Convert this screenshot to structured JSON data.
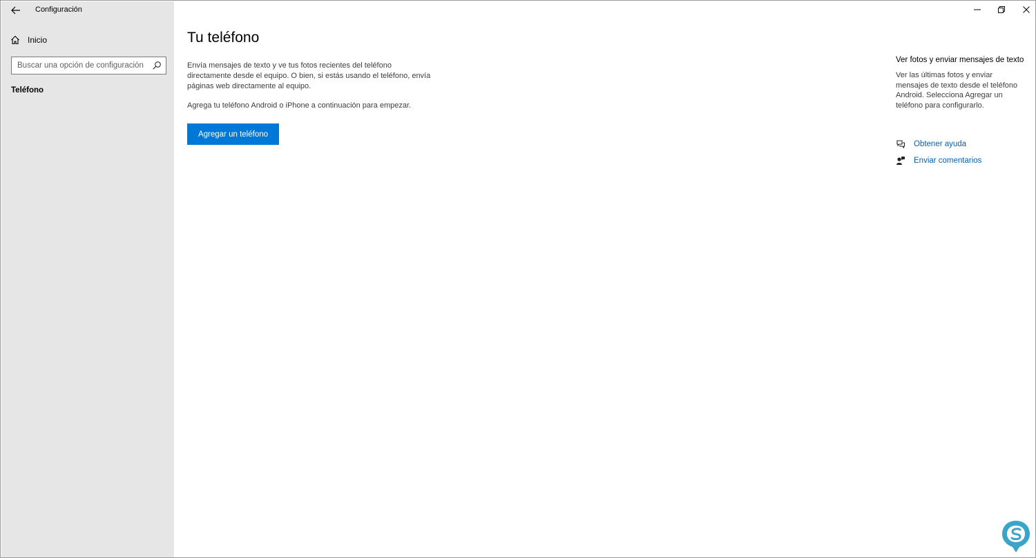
{
  "window": {
    "title": "Configuración",
    "controls": {
      "minimize": "minimize-icon",
      "restore": "restore-icon",
      "close": "close-icon"
    }
  },
  "sidebar": {
    "home_label": "Inicio",
    "search_placeholder": "Buscar una opción de configuración",
    "nav_items": [
      {
        "label": "Teléfono",
        "selected": true
      }
    ]
  },
  "main": {
    "title": "Tu teléfono",
    "description": "Envía mensajes de texto y ve tus fotos recientes del teléfono directamente desde el equipo. O bien, si estás usando el teléfono, envía páginas web directamente al equipo.",
    "instruction": "Agrega tu teléfono Android o iPhone a continuación para empezar.",
    "add_button_label": "Agregar un teléfono"
  },
  "right_rail": {
    "title": "Ver fotos y enviar mensajes de texto",
    "description": "Ver las últimas fotos y enviar mensajes de texto desde el teléfono Android. Selecciona Agregar un teléfono para configurarlo.",
    "links": [
      {
        "label": "Obtener ayuda",
        "icon": "help-chat-icon"
      },
      {
        "label": "Enviar comentarios",
        "icon": "feedback-icon"
      }
    ]
  },
  "colors": {
    "accent": "#0078d7",
    "link": "#0063b1",
    "sidebar_bg": "#e6e6e6",
    "logo": "#3aa5c9"
  }
}
